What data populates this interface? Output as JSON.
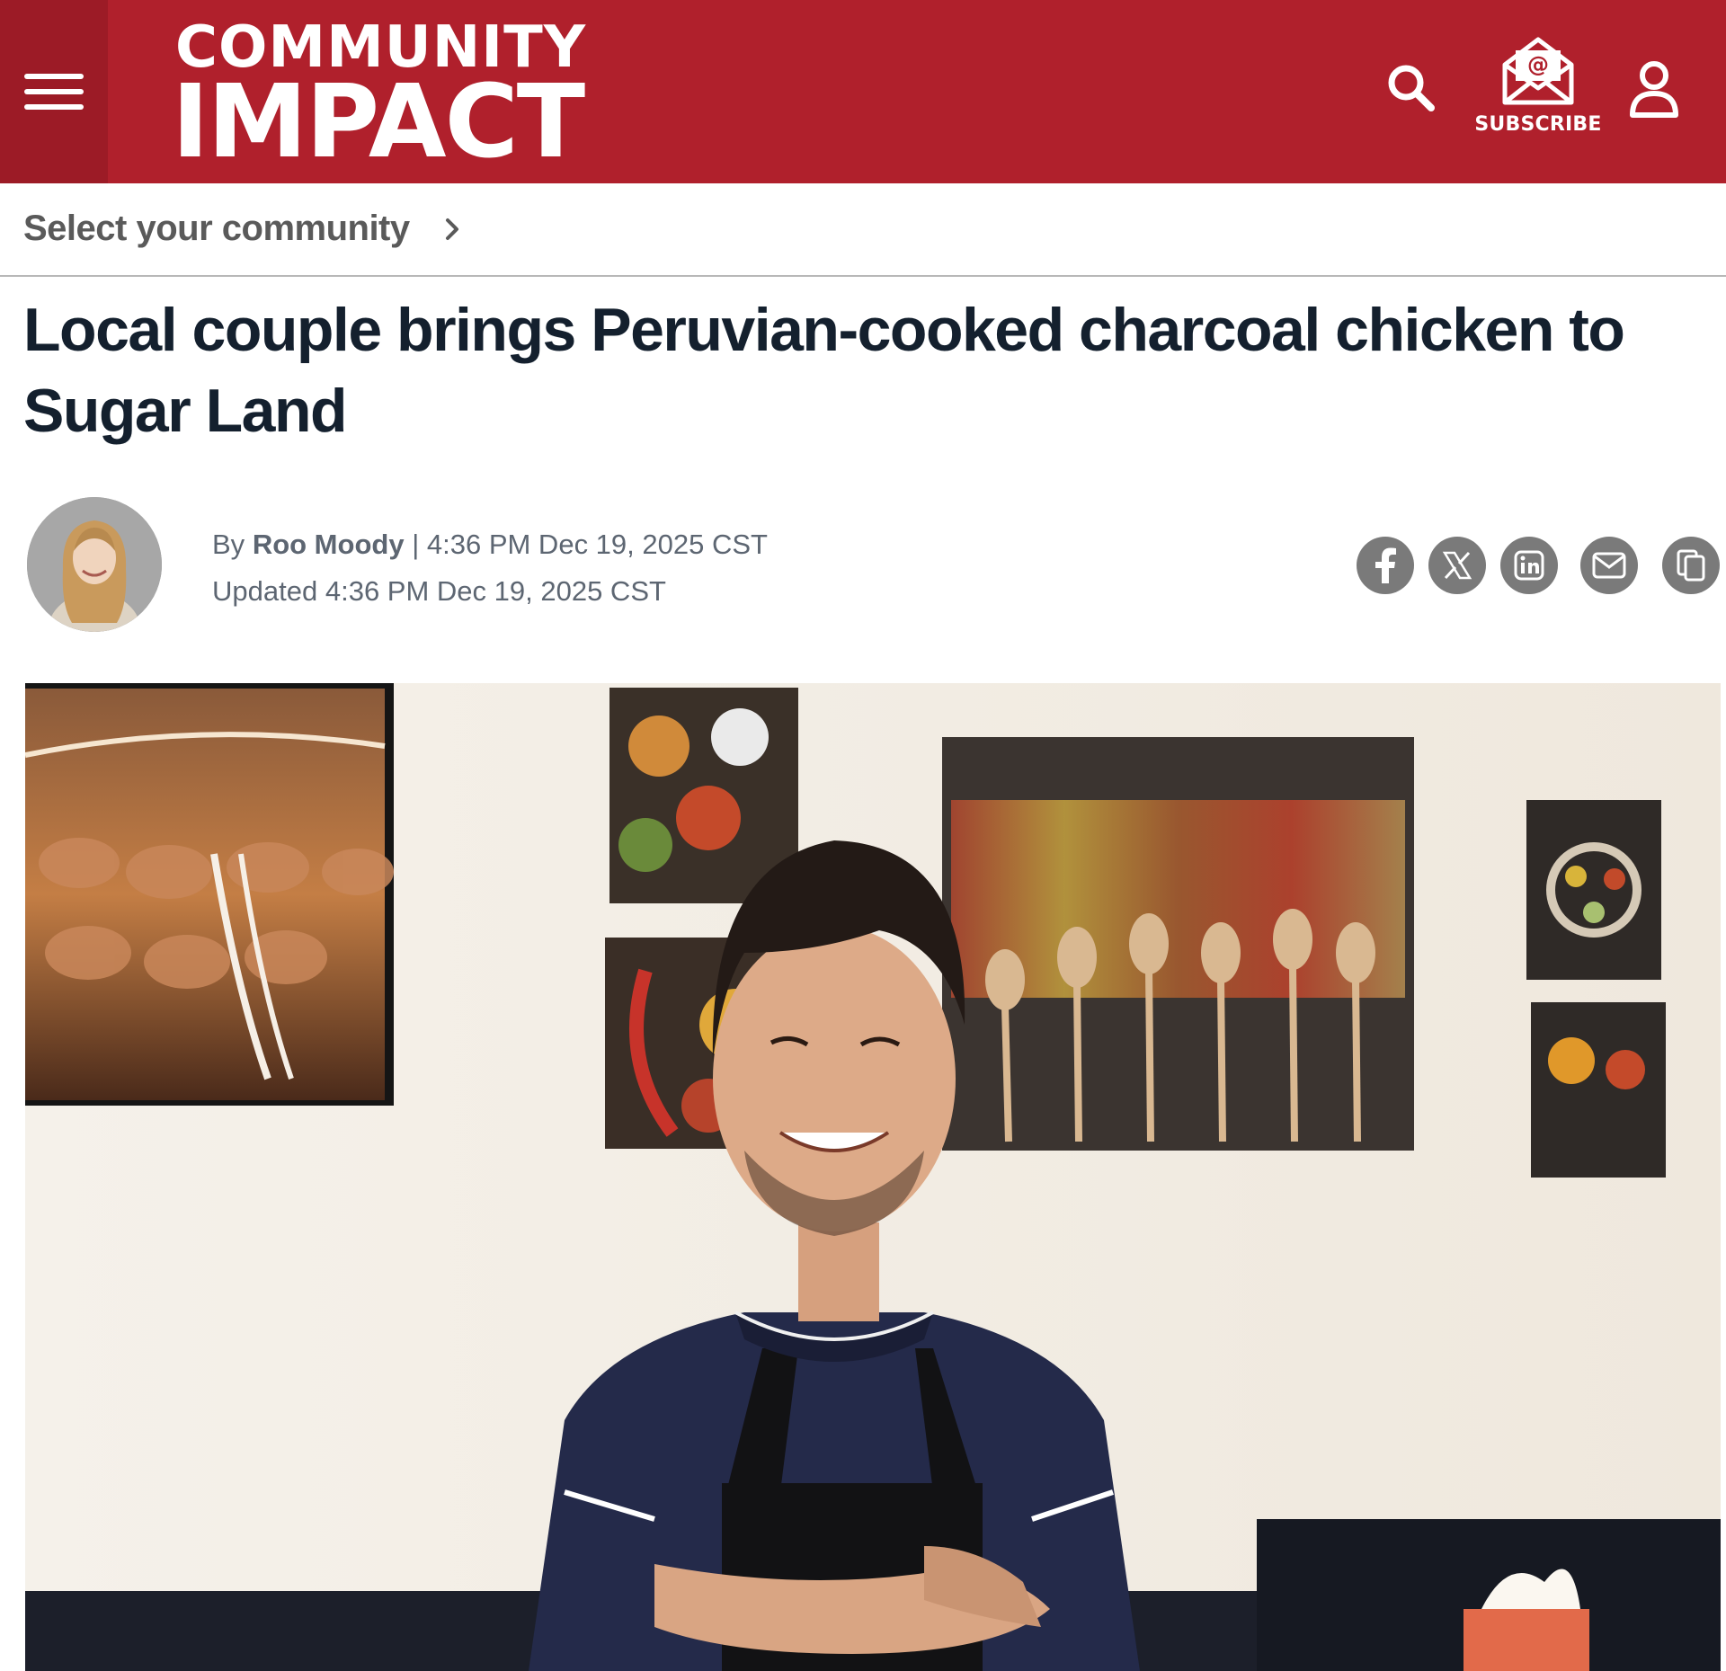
{
  "header": {
    "logo_top": "COMMUNITY",
    "logo_bottom": "IMPACT",
    "subscribe_label": "SUBSCRIBE",
    "brand_color": "#b0202c"
  },
  "community": {
    "label": "Select your community"
  },
  "article": {
    "title": "Local couple brings Peruvian-cooked charcoal chicken to Sugar Land",
    "by_prefix": "By",
    "author": "Roo Moody",
    "separator": "|",
    "published": "4:36 PM Dec 19, 2025 CST",
    "updated_label": "Updated",
    "updated": "4:36 PM Dec 19, 2025 CST"
  },
  "share_icons": [
    "facebook-icon",
    "x-icon",
    "linkedin-icon",
    "email-icon",
    "copy-link-icon"
  ]
}
